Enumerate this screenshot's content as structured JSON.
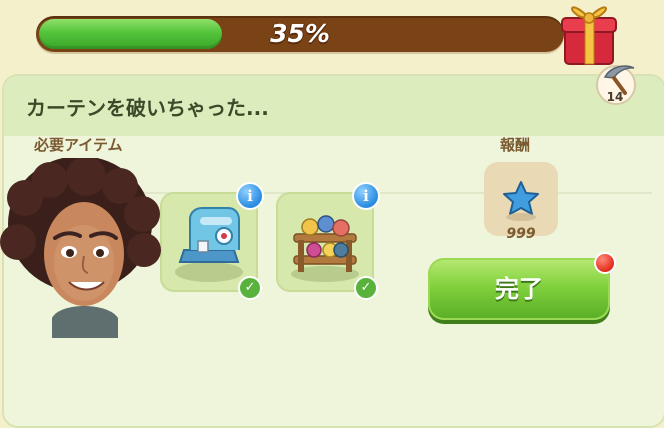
{
  "progress": {
    "value": 0.35,
    "label": "35%"
  },
  "task": {
    "title": "カーテンを破いちゃった..."
  },
  "pickaxe": {
    "count": "14"
  },
  "required_items": {
    "label": "必要アイテム",
    "items": [
      {
        "name": "sewing-machine"
      },
      {
        "name": "fabric-rolls-shelf"
      }
    ]
  },
  "reward": {
    "label": "報酬",
    "amount": "999",
    "icon": "blue-star-icon"
  },
  "complete_button": {
    "label": "完了"
  },
  "colors": {
    "progress_fill": "#54c43b",
    "progress_track": "#7a4315",
    "button_green": "#7fcf3b",
    "notification": "#e32b1c"
  }
}
